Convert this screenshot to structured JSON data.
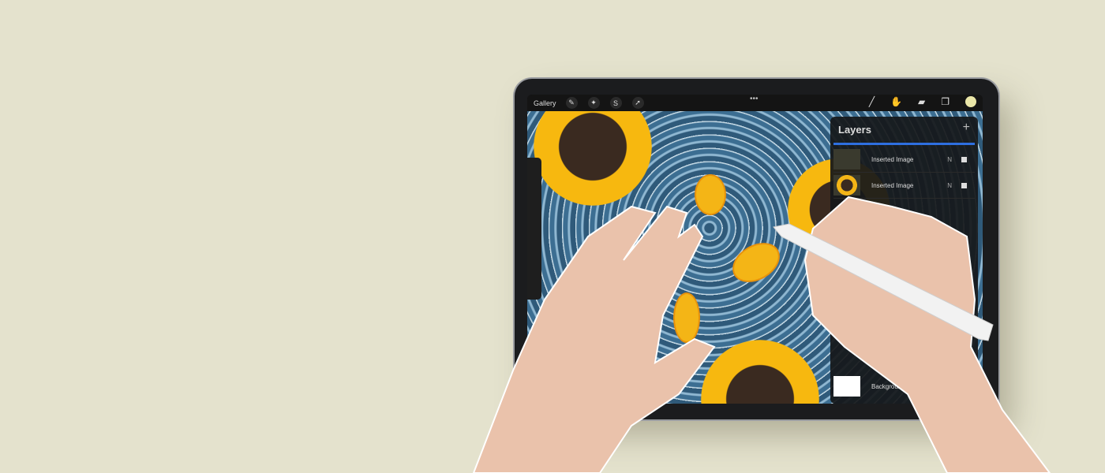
{
  "toolbar": {
    "gallery": "Gallery",
    "more": "•••",
    "icons": [
      "wrench-icon",
      "magic-wand-icon",
      "selection-icon",
      "arrow-icon",
      "brush-icon",
      "smudge-icon",
      "eraser-icon",
      "layers-icon",
      "color-icon"
    ],
    "active_color": "#eae6a8"
  },
  "layers": {
    "title": "Layers",
    "add": "+",
    "items": [
      {
        "name": "Inserted Image",
        "mode": "N",
        "visible": true
      },
      {
        "name": "Inserted Image",
        "mode": "N",
        "visible": true
      },
      {
        "name": "Background color",
        "mode": "",
        "visible": true
      }
    ]
  },
  "colors": {
    "background": "#e4e2cd",
    "accent": "#2e6fe0",
    "sunflower": "#f4b516"
  }
}
